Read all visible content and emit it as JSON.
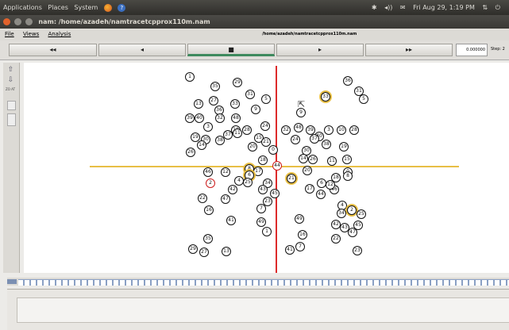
{
  "topbar": {
    "menus": [
      "Applications",
      "Places",
      "System"
    ],
    "clock": "Fri Aug 29,  1:19 PM",
    "indicators": [
      "bluetooth-icon",
      "volume-icon",
      "mail-icon",
      "network-icon",
      "power-icon"
    ]
  },
  "window": {
    "title": "nam: /home/azadeh/namtracetcpprox110m.nam"
  },
  "menubar": {
    "file": "File",
    "views": "Views",
    "analysis": "Analysis",
    "path": "/home/azadeh/namtracetcpprox110m.nam"
  },
  "controls": {
    "rewind": "◂◂",
    "back": "◂",
    "stop": "■",
    "play": "▸",
    "fast_forward": "▸▸",
    "time": "0.000000",
    "step_label": "Step: 2"
  },
  "sidebar": {
    "zoom_text": "ZO\nAT"
  },
  "colors": {
    "highlight": "#e8bf45",
    "cursor_line": "#dd2b2b",
    "node_border": "#111111"
  },
  "nodes": [
    {
      "label": "1"
    },
    {
      "label": "35"
    },
    {
      "label": "29"
    },
    {
      "label": "27"
    },
    {
      "label": "13"
    },
    {
      "label": "36"
    },
    {
      "label": "31"
    },
    {
      "label": "5"
    },
    {
      "label": "33"
    },
    {
      "label": "9"
    },
    {
      "label": "32"
    },
    {
      "label": "48"
    },
    {
      "label": "39"
    },
    {
      "label": "40"
    },
    {
      "label": "3"
    },
    {
      "label": "10"
    },
    {
      "label": "28"
    },
    {
      "label": "24"
    },
    {
      "label": "37"
    },
    {
      "label": "38"
    },
    {
      "label": "19"
    },
    {
      "label": "30"
    },
    {
      "label": "14"
    },
    {
      "label": "26"
    },
    {
      "label": "11"
    },
    {
      "label": "15"
    },
    {
      "label": "21"
    },
    {
      "label": "20"
    },
    {
      "label": "0"
    },
    {
      "label": "18"
    },
    {
      "label": "8"
    },
    {
      "label": "17"
    },
    {
      "label": "44"
    },
    {
      "label": "46"
    },
    {
      "label": "12"
    },
    {
      "label": "6"
    },
    {
      "label": "4"
    },
    {
      "label": "2"
    },
    {
      "label": "25"
    },
    {
      "label": "34"
    },
    {
      "label": "42"
    },
    {
      "label": "43"
    },
    {
      "label": "45"
    },
    {
      "label": "47"
    },
    {
      "label": "22"
    },
    {
      "label": "23"
    },
    {
      "label": "16"
    },
    {
      "label": "7"
    },
    {
      "label": "41"
    },
    {
      "label": "49"
    }
  ]
}
